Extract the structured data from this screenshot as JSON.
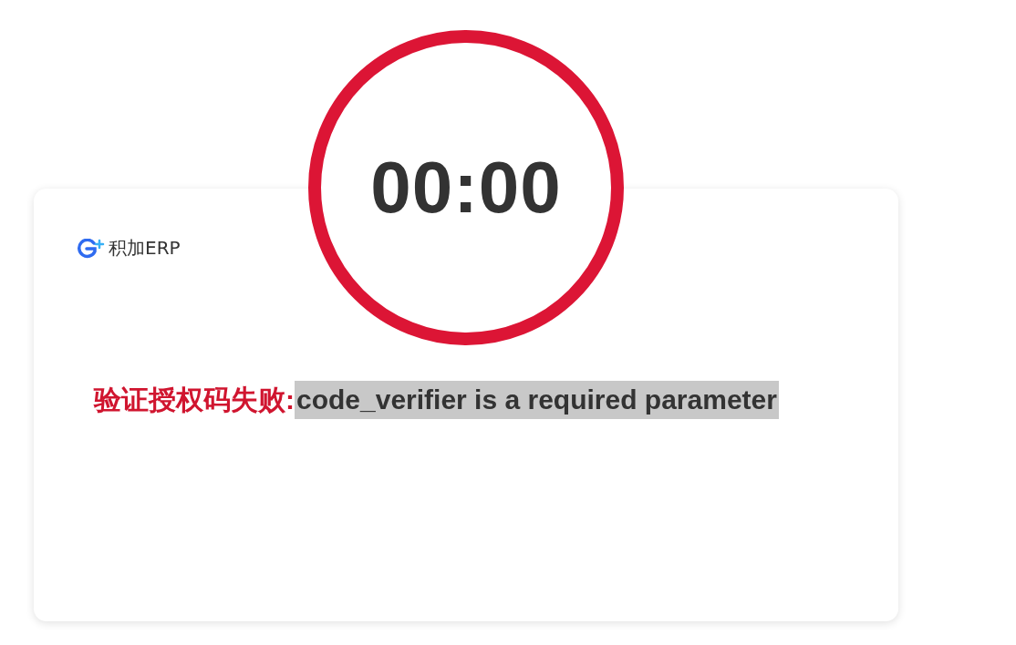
{
  "timer": {
    "text": "00:00"
  },
  "card": {
    "logo": {
      "text": "积加ERP"
    },
    "message": {
      "label": "验证授权码失败:",
      "detail": "code_verifier is a required parameter",
      "detail_selected": true
    }
  }
}
